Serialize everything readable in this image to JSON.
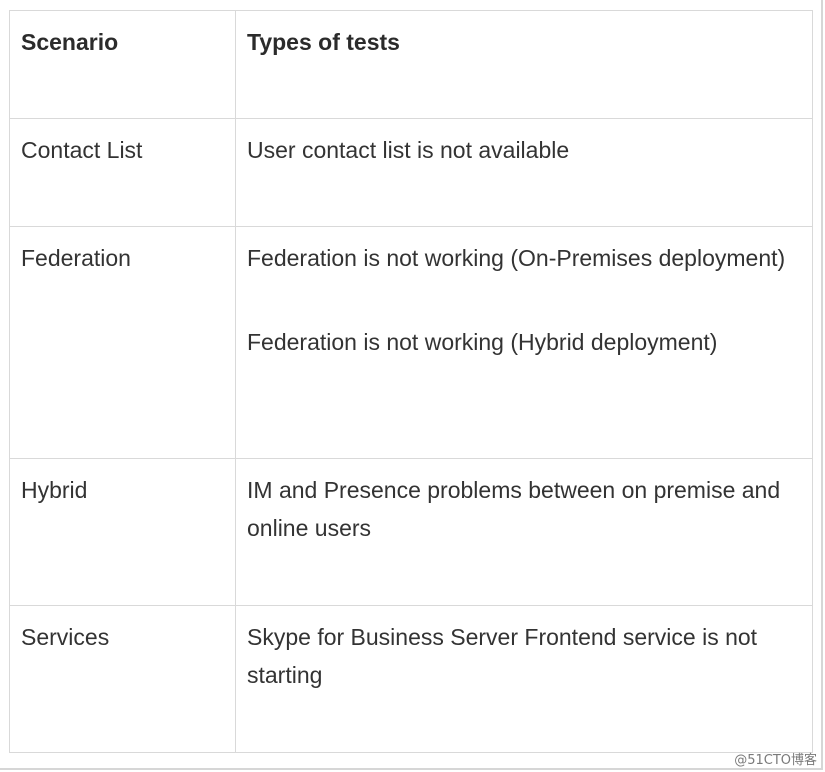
{
  "table": {
    "headers": [
      "Scenario",
      "Types of tests"
    ],
    "rows": [
      {
        "scenario": "Contact List",
        "tests": [
          "User contact list is not available"
        ]
      },
      {
        "scenario": "Federation",
        "tests": [
          "Federation is not working (On-Premises deployment)",
          "Federation is not working (Hybrid deployment)"
        ]
      },
      {
        "scenario": "Hybrid",
        "tests": [
          "IM and Presence problems between on premise and online users"
        ]
      },
      {
        "scenario": "Services",
        "tests": [
          "Skype for Business Server Frontend service is not starting"
        ]
      }
    ]
  },
  "watermark": "@51CTO博客"
}
